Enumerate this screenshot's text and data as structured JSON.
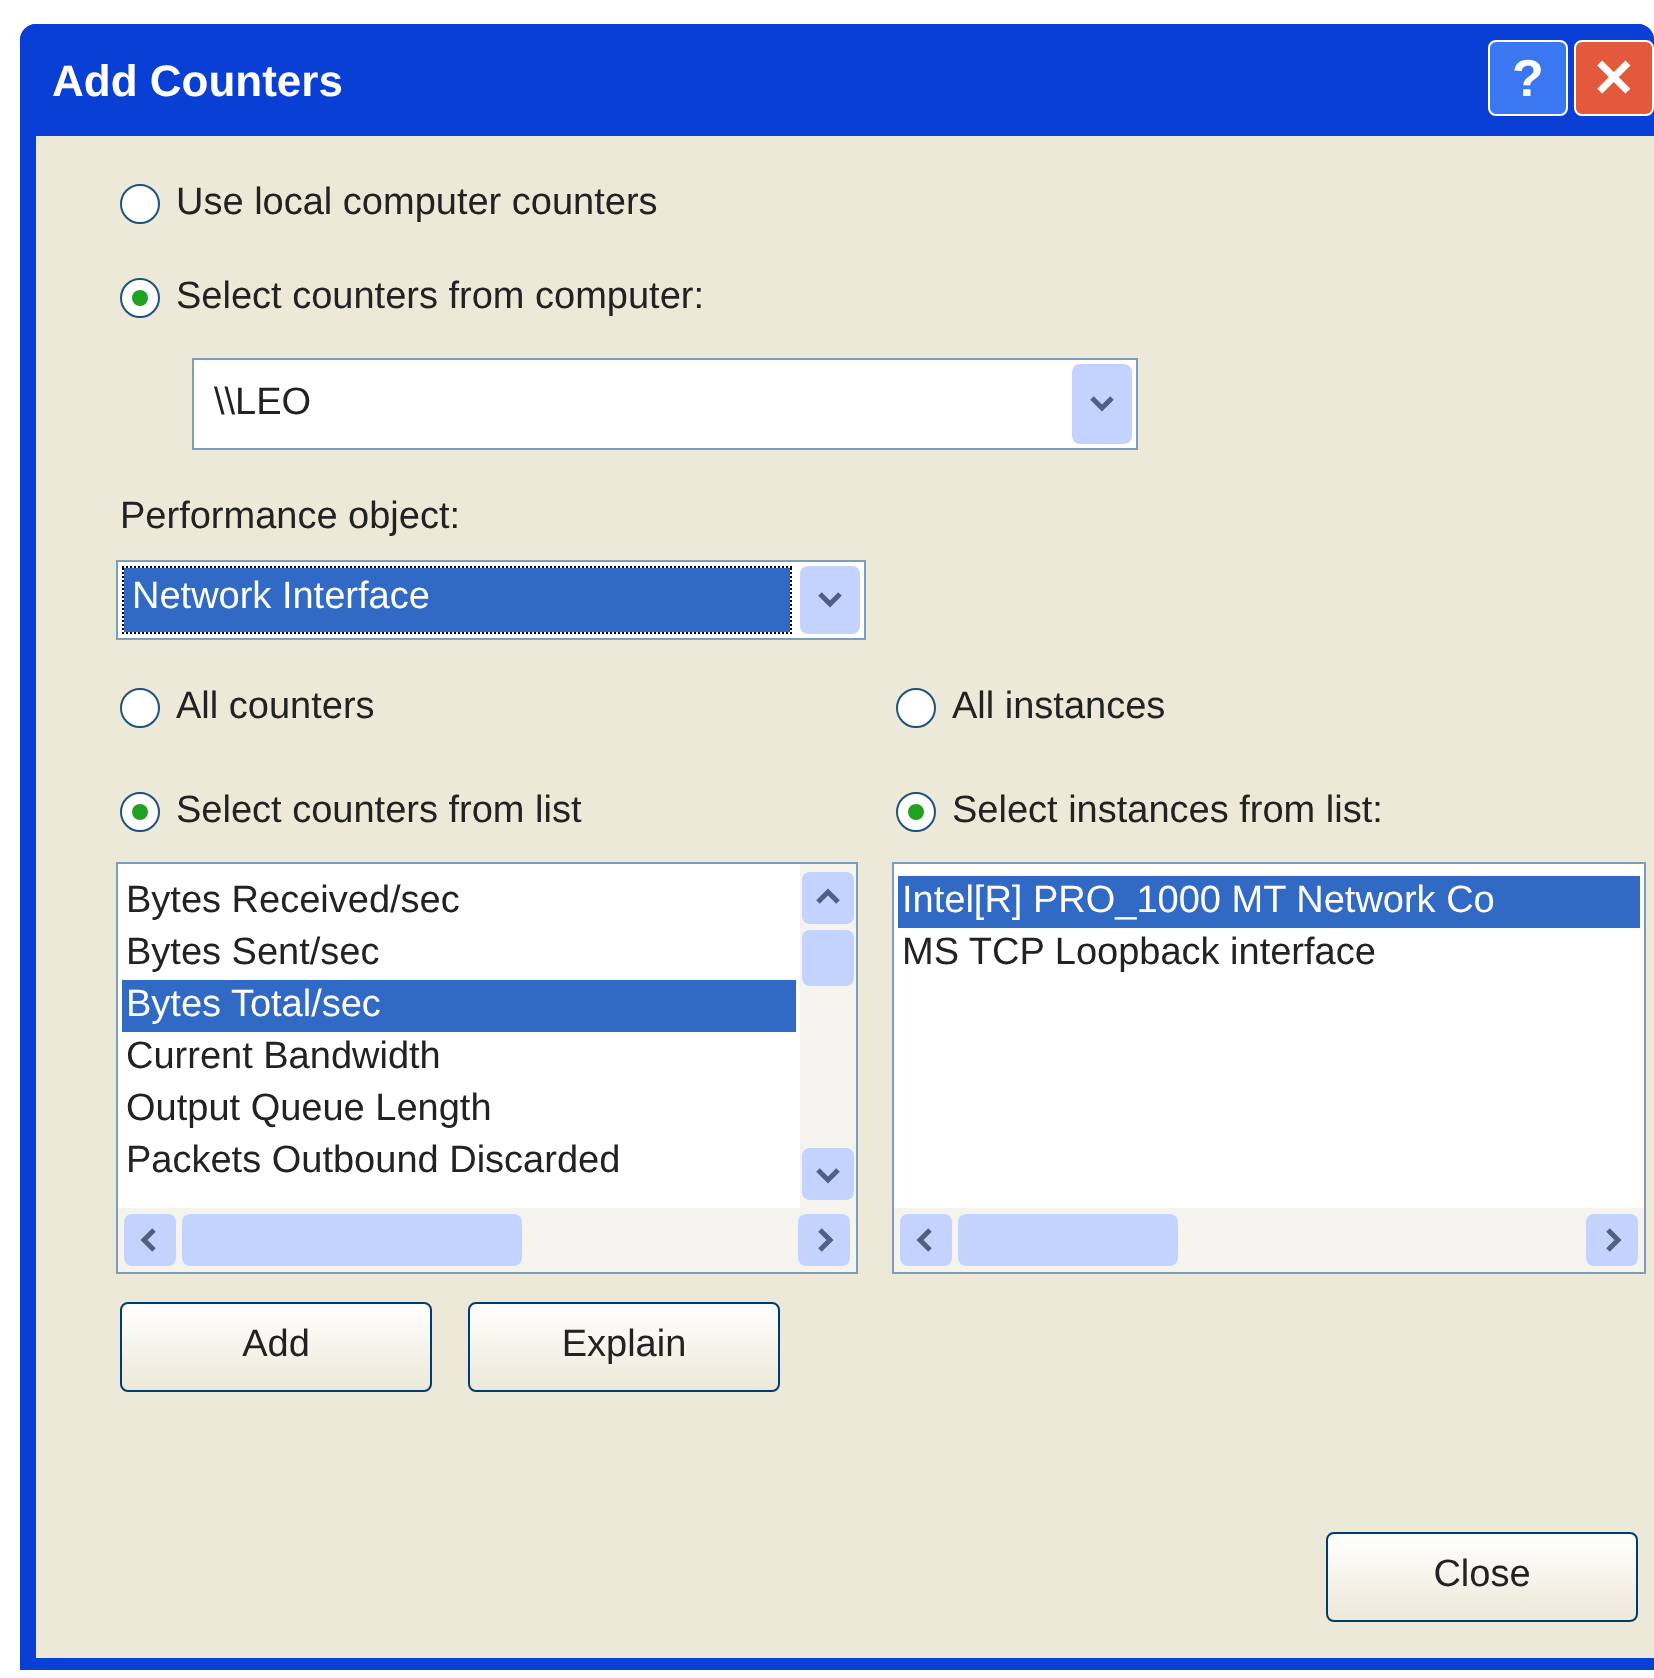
{
  "window": {
    "title": "Add Counters",
    "controls": [
      "?",
      "✕"
    ]
  },
  "source": [
    {
      "label": "Use local computer counters",
      "selected": false
    },
    {
      "label": "Select counters from computer:",
      "selected": true
    }
  ],
  "computer": {
    "value": "\\\\LEO"
  },
  "performance_object": {
    "label": "Performance object:",
    "value": "Network Interface"
  },
  "counter_mode": [
    {
      "label": "All counters",
      "selected": false
    },
    {
      "label": "Select counters from list",
      "selected": true
    }
  ],
  "instance_mode": [
    {
      "label": "All instances",
      "selected": false
    },
    {
      "label": "Select instances from list:",
      "selected": true
    }
  ],
  "counters": [
    {
      "label": "Bytes Received/sec",
      "selected": false
    },
    {
      "label": "Bytes Sent/sec",
      "selected": false
    },
    {
      "label": "Bytes Total/sec",
      "selected": true
    },
    {
      "label": "Current Bandwidth",
      "selected": false
    },
    {
      "label": "Output Queue Length",
      "selected": false
    },
    {
      "label": "Packets Outbound Discarded",
      "selected": false
    }
  ],
  "instances": [
    {
      "label": "Intel[R] PRO_1000 MT Network Co",
      "selected": true
    },
    {
      "label": "MS TCP Loopback interface",
      "selected": false
    }
  ],
  "buttons": [
    "Add",
    "Explain"
  ],
  "close_button": "Close"
}
